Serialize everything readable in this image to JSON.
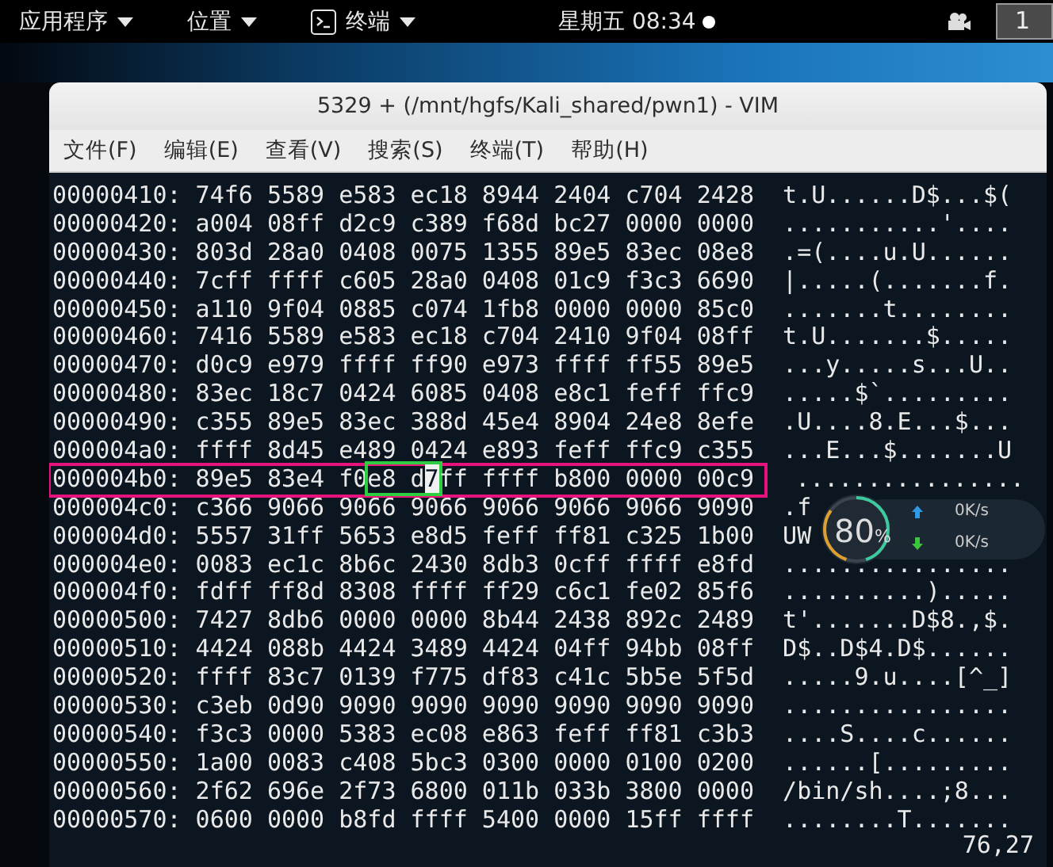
{
  "top_bar": {
    "menus": [
      {
        "label": "应用程序",
        "kind": "plain"
      },
      {
        "label": "位置",
        "kind": "plain"
      },
      {
        "label": "终端",
        "kind": "terminal"
      }
    ],
    "clock": "星期五 08:34",
    "workspace": "1"
  },
  "window": {
    "title": "5329 + (/mnt/hgfs/Kali_shared/pwn1) - VIM",
    "menu": [
      "文件(F)",
      "编辑(E)",
      "查看(V)",
      "搜索(S)",
      "终端(T)",
      "帮助(H)"
    ]
  },
  "editor": {
    "rows": [
      {
        "offset": "00000410:",
        "hex": "74f6 5589 e583 ec18 8944 2404 c704 2428",
        "ascii": "t.U......D$...$(",
        "marked": false
      },
      {
        "offset": "00000420:",
        "hex": "a004 08ff d2c9 c389 f68d bc27 0000 0000",
        "ascii": "...........'....",
        "marked": false
      },
      {
        "offset": "00000430:",
        "hex": "803d 28a0 0408 0075 1355 89e5 83ec 08e8",
        "ascii": ".=(....u.U......",
        "marked": false
      },
      {
        "offset": "00000440:",
        "hex": "7cff ffff c605 28a0 0408 01c9 f3c3 6690",
        "ascii": "|.....(.......f.",
        "marked": false
      },
      {
        "offset": "00000450:",
        "hex": "a110 9f04 0885 c074 1fb8 0000 0000 85c0",
        "ascii": ".......t........",
        "marked": false
      },
      {
        "offset": "00000460:",
        "hex": "7416 5589 e583 ec18 c704 2410 9f04 08ff",
        "ascii": "t.U.......$.....",
        "marked": false
      },
      {
        "offset": "00000470:",
        "hex": "d0c9 e979 ffff ff90 e973 ffff ff55 89e5",
        "ascii": "...y.....s...U..",
        "marked": false
      },
      {
        "offset": "00000480:",
        "hex": "83ec 18c7 0424 6085 0408 e8c1 feff ffc9",
        "ascii": ".....$`.........",
        "marked": false
      },
      {
        "offset": "00000490:",
        "hex": "c355 89e5 83ec 388d 45e4 8904 24e8 8efe",
        "ascii": ".U....8.E...$...",
        "marked": false
      },
      {
        "offset": "000004a0:",
        "hex": "ffff 8d45 e489 0424 e893 feff ffc9 c355",
        "ascii": "...E...$.......U",
        "marked": false
      },
      {
        "offset": "000004b0:",
        "segments": [
          {
            "kind": "plain",
            "text": "89e5 83e4 f0"
          },
          {
            "kind": "match",
            "text": "e8 d",
            "cursor": "7"
          },
          {
            "kind": "plain",
            "text": "ff ffff b800 0000 00c9"
          }
        ],
        "ascii": "................",
        "marked": true
      },
      {
        "offset": "000004c0:",
        "hex": "c366 9066 9066 9066 9066 9066 9066 9090",
        "ascii": ".f",
        "marked": false
      },
      {
        "offset": "000004d0:",
        "hex": "5557 31ff 5653 e8d5 feff ff81 c325 1b00",
        "ascii": "UW",
        "marked": false
      },
      {
        "offset": "000004e0:",
        "hex": "0083 ec1c 8b6c 2430 8db3 0cff ffff e8fd",
        "ascii": "................",
        "marked": false
      },
      {
        "offset": "000004f0:",
        "hex": "fdff ff8d 8308 ffff ff29 c6c1 fe02 85f6",
        "ascii": "..........).....",
        "marked": false
      },
      {
        "offset": "00000500:",
        "hex": "7427 8db6 0000 0000 8b44 2438 892c 2489",
        "ascii": "t'.......D$8.,$.",
        "marked": false
      },
      {
        "offset": "00000510:",
        "hex": "4424 088b 4424 3489 4424 04ff 94bb 08ff",
        "ascii": "D$..D$4.D$......",
        "marked": false
      },
      {
        "offset": "00000520:",
        "hex": "ffff 83c7 0139 f775 df83 c41c 5b5e 5f5d",
        "ascii": ".....9.u....[^_]",
        "marked": false
      },
      {
        "offset": "00000530:",
        "hex": "c3eb 0d90 9090 9090 9090 9090 9090 9090",
        "ascii": "................",
        "marked": false
      },
      {
        "offset": "00000540:",
        "hex": "f3c3 0000 5383 ec08 e863 feff ff81 c3b3",
        "ascii": "....S....c......",
        "marked": false
      },
      {
        "offset": "00000550:",
        "hex": "1a00 0083 c408 5bc3 0300 0000 0100 0200",
        "ascii": "......[.........",
        "marked": false
      },
      {
        "offset": "00000560:",
        "hex": "2f62 696e 2f73 6800 011b 033b 3800 0000",
        "ascii": "/bin/sh....;8...",
        "marked": false
      },
      {
        "offset": "00000570:",
        "hex": "0600 0000 b8fd ffff 5400 0000 15ff ffff",
        "ascii": "........T.......",
        "marked": false
      }
    ],
    "status": "76,27"
  },
  "net_widget": {
    "percent": "80",
    "unit": "%",
    "upload": "0K/s",
    "download": "0K/s"
  }
}
